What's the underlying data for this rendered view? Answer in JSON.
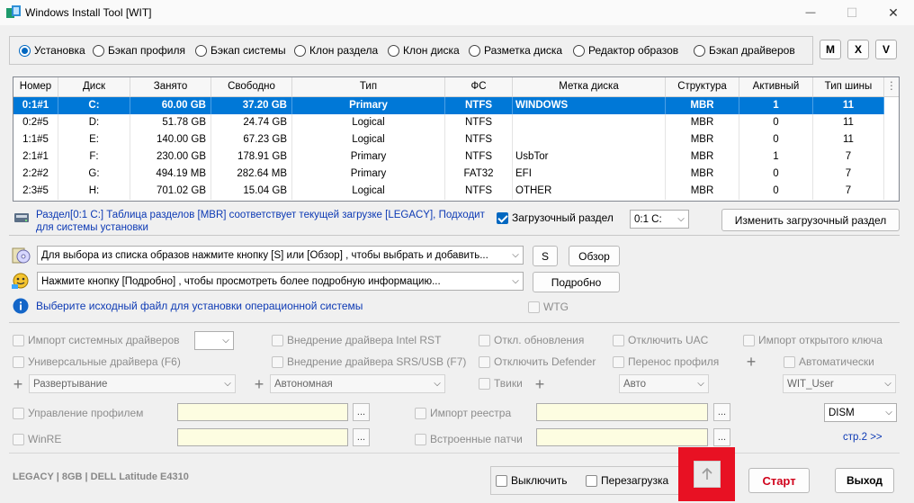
{
  "window": {
    "title": "Windows Install Tool [WIT]",
    "minimize": "—",
    "maximize": "☐",
    "close": "✕"
  },
  "modes": [
    {
      "label": "Установка",
      "selected": true
    },
    {
      "label": "Бэкап профиля",
      "selected": false
    },
    {
      "label": "Бэкап системы",
      "selected": false
    },
    {
      "label": "Клон раздела",
      "selected": false
    },
    {
      "label": "Клон диска",
      "selected": false
    },
    {
      "label": "Разметка диска",
      "selected": false
    },
    {
      "label": "Редактор образов",
      "selected": false
    },
    {
      "label": "Бэкап драйверов",
      "selected": false
    }
  ],
  "mode_buttons": {
    "m": "M",
    "x": "X",
    "v": "V"
  },
  "table": {
    "columns": [
      "Номер",
      "Диск",
      "Занято",
      "Свободно",
      "Тип",
      "ФС",
      "Метка диска",
      "Структура",
      "Активный",
      "Тип шины"
    ],
    "rows": [
      [
        "0:1#1",
        "C:",
        "60.00 GB",
        "37.20 GB",
        "Primary",
        "NTFS",
        "WINDOWS",
        "MBR",
        "1",
        "11"
      ],
      [
        "0:2#5",
        "D:",
        "51.78 GB",
        "24.74 GB",
        "Logical",
        "NTFS",
        "",
        "MBR",
        "0",
        "11"
      ],
      [
        "1:1#5",
        "E:",
        "140.00 GB",
        "67.23 GB",
        "Logical",
        "NTFS",
        "",
        "MBR",
        "0",
        "11"
      ],
      [
        "2:1#1",
        "F:",
        "230.00 GB",
        "178.91 GB",
        "Primary",
        "NTFS",
        "UsbTor",
        "MBR",
        "1",
        "7"
      ],
      [
        "2:2#2",
        "G:",
        "494.19 MB",
        "282.64 MB",
        "Primary",
        "FAT32",
        "EFI",
        "MBR",
        "0",
        "7"
      ],
      [
        "2:3#5",
        "H:",
        "701.02 GB",
        "15.04 GB",
        "Logical",
        "NTFS",
        "OTHER",
        "MBR",
        "0",
        "7"
      ]
    ],
    "selected_row": 0
  },
  "partition_info": {
    "text": "Раздел[0:1 C:] Таблица разделов [MBR] соответствует текущей загрузке [LEGACY], Подходит для системы установки",
    "boot_check_label": "Загрузочный раздел",
    "boot_select_value": "0:1 C:",
    "change_boot_button": "Изменить загрузочный раздел"
  },
  "image": {
    "select_value": "Для выбора из списка образов нажмите кнопку [S] или [Обзор] , чтобы выбрать и добавить...",
    "s_button": "S",
    "browse_button": "Обзор",
    "details_select_value": "Нажмите кнопку [Подробно] , чтобы просмотреть более подробную информацию...",
    "details_button": "Подробно",
    "hint": "Выберите исходный файл для установки операционной системы",
    "wtg_label": "WTG"
  },
  "options": {
    "import_drivers": "Импорт системных драйверов",
    "intel_rst": "Внедрение драйвера Intel RST",
    "disable_updates": "Откл. обновления",
    "disable_uac": "Отключить UAC",
    "import_key": "Импорт открытого ключа",
    "universal_drivers": "Универсальные драйвера (F6)",
    "srs_usb": "Внедрение драйвера SRS/USB (F7)",
    "disable_defender": "Отключить Defender",
    "profile_move": "Перенос профиля",
    "auto": "Автоматически",
    "deploy_select": "Развертывание",
    "standalone_select": "Автономная",
    "tweaks": "Твики",
    "auto_select": "Авто",
    "user_select": "WIT_User",
    "profile_manage": "Управление профилем",
    "registry_import": "Импорт реестра",
    "dism_select": "DISM",
    "winre": "WinRE",
    "builtin_patches": "Встроенные патчи",
    "page2_link": "стр.2 >>",
    "dots": "..."
  },
  "footer": {
    "info": "LEGACY | 8GB | DELL Latitude E4310",
    "shutdown": "Выключить",
    "reboot": "Перезагрузка",
    "start_button": "Старт",
    "exit_button": "Выход"
  },
  "colors": {
    "accent": "#0078d7",
    "highlight": "#e81123",
    "info_text": "#0c39b4",
    "start_text": "#d0021b"
  }
}
